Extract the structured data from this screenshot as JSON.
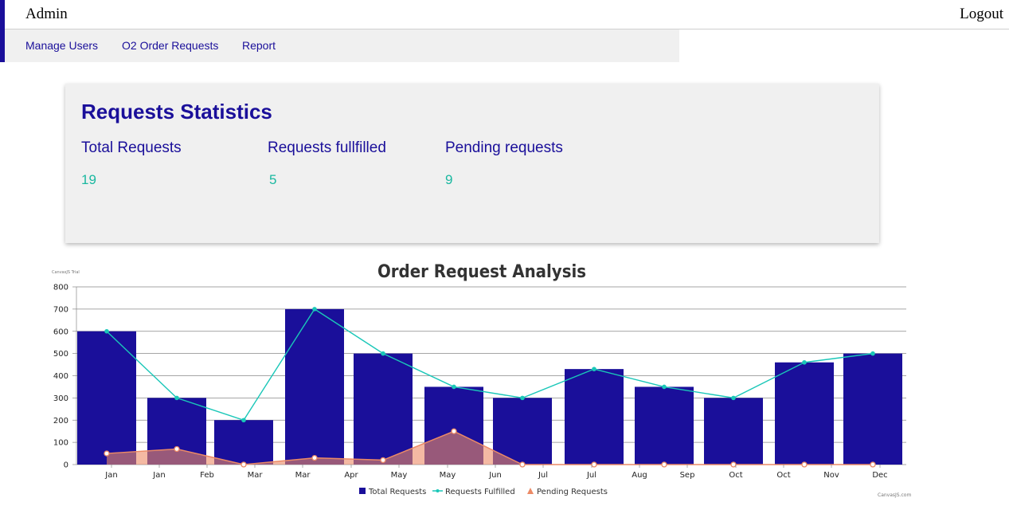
{
  "header": {
    "title": "Admin",
    "logout": "Logout"
  },
  "nav": {
    "items": [
      "Manage Users",
      "O2 Order Requests",
      "Report"
    ]
  },
  "stats": {
    "heading": "Requests Statistics",
    "items": [
      {
        "label": "Total Requests",
        "value": "19"
      },
      {
        "label": "Requests fullfilled",
        "value": "5"
      },
      {
        "label": "Pending requests",
        "value": "9"
      }
    ]
  },
  "colors": {
    "accent": "#1a0f9a",
    "stat_value": "#1ab8a0",
    "fulfilled": "#1ac7b8",
    "pending": "#ec8a66",
    "pending_fill": "#a95a5e"
  },
  "chart_data": {
    "type": "bar",
    "title": "Order Request Analysis",
    "watermark_top": "CanvasJS Trial",
    "watermark_bottom": "CanvasJS.com",
    "ylim": [
      0,
      800
    ],
    "yticks": [
      0,
      100,
      200,
      300,
      400,
      500,
      600,
      700,
      800
    ],
    "grid": true,
    "legend_position": "bottom-center",
    "x_tick_labels": [
      "Jan",
      "Jan",
      "Feb",
      "Mar",
      "Mar",
      "Apr",
      "May",
      "May",
      "Jun",
      "Jul",
      "Jul",
      "Aug",
      "Sep",
      "Oct",
      "Oct",
      "Nov",
      "Dec"
    ],
    "series": [
      {
        "name": "Total Requests",
        "type": "bar",
        "values": [
          600,
          300,
          200,
          700,
          500,
          350,
          300,
          430,
          350,
          300,
          460,
          500
        ]
      },
      {
        "name": "Requests Fulfilled",
        "type": "line",
        "values": [
          600,
          300,
          200,
          700,
          500,
          350,
          300,
          430,
          350,
          300,
          460,
          500
        ]
      },
      {
        "name": "Pending Requests",
        "type": "area",
        "values": [
          50,
          70,
          0,
          30,
          20,
          150,
          0,
          0,
          0,
          0,
          0,
          0
        ]
      }
    ]
  }
}
